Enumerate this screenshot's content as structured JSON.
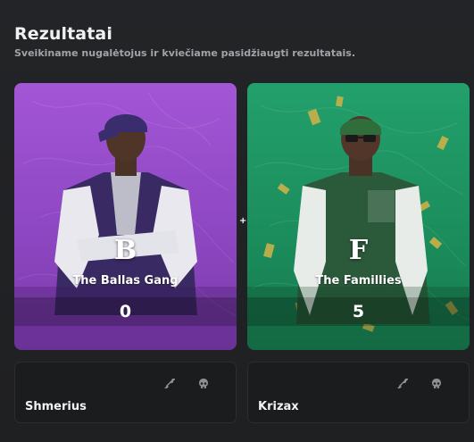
{
  "header": {
    "title": "Rezultatai",
    "subtitle": "Sveikiname nugalėtojus ir kviečiame pasidžiaugti rezultatais."
  },
  "teams": [
    {
      "name": "The Ballas Gang",
      "emblem": "B",
      "score": "0",
      "accent": "#9b51d2",
      "icon": "ballas-emblem-icon"
    },
    {
      "name": "The Famillies",
      "emblem": "F",
      "score": "5",
      "accent": "#1f9a66",
      "icon": "families-emblem-icon"
    }
  ],
  "separator": "+",
  "players": [
    {
      "name": "Shmerius",
      "icons": [
        "rifle-icon",
        "skull-icon"
      ]
    },
    {
      "name": "Krizax",
      "icons": [
        "rifle-icon",
        "skull-icon"
      ]
    }
  ]
}
